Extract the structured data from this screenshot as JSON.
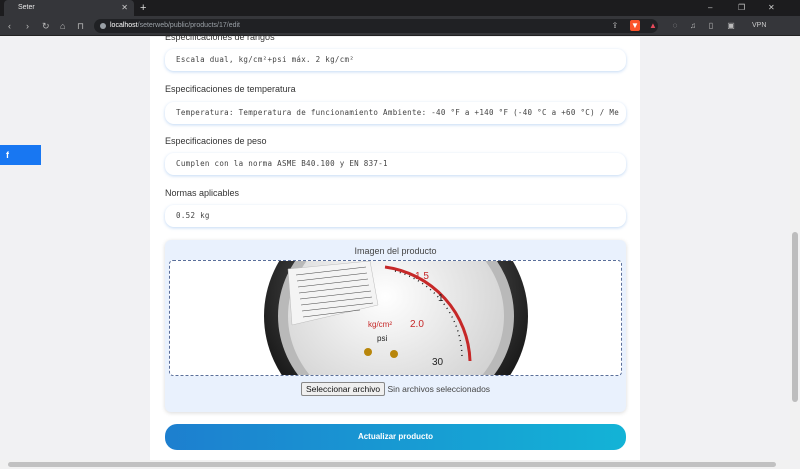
{
  "browser": {
    "tab_title": "Seter",
    "tab_close": "✕",
    "new_tab": "+",
    "url_host": "localhost",
    "url_path": "/seterweb/public/products/17/edit",
    "vpn_label": "VPN",
    "back": "‹",
    "forward": "›",
    "reload": "↻",
    "minimize": "–",
    "maximize": "❐",
    "close": "✕",
    "accent": "#fb542b"
  },
  "form": {
    "rangos_label": "Especificaciones de rangos",
    "rangos_value": "Escala dual, kg/cm²+psi máx. 2 kg/cm²",
    "temperatura_label": "Especificaciones de temperatura",
    "temperatura_value": "Temperatura: Temperatura de funcionamiento Ambiente: -40 °F a +140 °F (-40 °C a +60 °C) / Me",
    "peso_label": "Especificaciones de peso",
    "peso_value": "Cumplen con la norma ASME B40.100 y EN 837-1",
    "normas_label": "Normas aplicables",
    "normas_value": "0.52 kg",
    "image_title": "Imagen del producto",
    "file_button": "Seleccionar archivo",
    "file_status": "Sin archivos seleccionados",
    "submit_label": "Actualizar producto",
    "submit_color": "#1d7fcf"
  },
  "social": {
    "facebook_icon": "f"
  }
}
